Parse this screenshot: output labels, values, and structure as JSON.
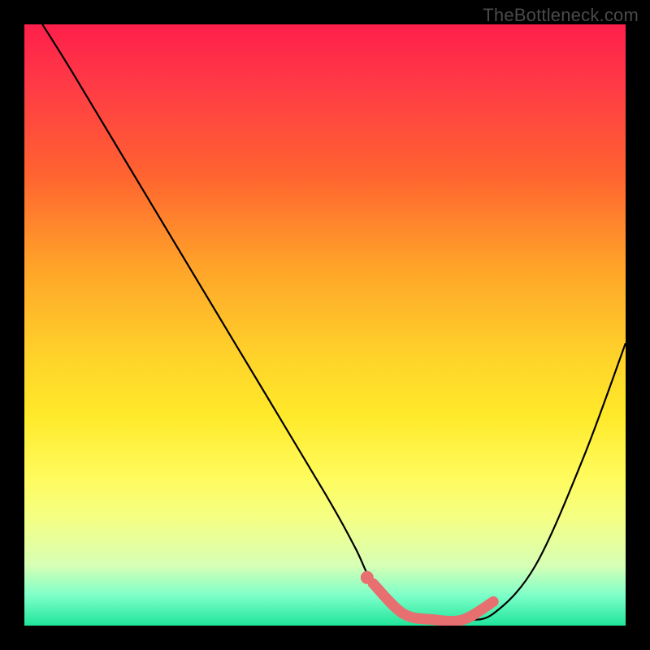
{
  "watermark": "TheBottleneck.com",
  "colors": {
    "curve": "#000000",
    "highlight": "#e76f6f",
    "highlight_dot": "#e76f6f",
    "background_frame": "#000000"
  },
  "chart_data": {
    "type": "line",
    "title": "",
    "xlabel": "",
    "ylabel": "",
    "xlim": [
      0,
      100
    ],
    "ylim": [
      0,
      100
    ],
    "grid": false,
    "legend": false,
    "series": [
      {
        "name": "bottleneck-curve",
        "x": [
          3,
          8,
          20,
          35,
          50,
          55,
          58,
          63,
          68,
          73,
          78,
          85,
          93,
          100
        ],
        "y": [
          100,
          92,
          72,
          47,
          22,
          13,
          7,
          2,
          1,
          1,
          2,
          10,
          28,
          47
        ]
      },
      {
        "name": "optimal-range-highlight",
        "x": [
          58,
          63,
          68,
          73,
          78
        ],
        "y": [
          7,
          2,
          1,
          1,
          4
        ]
      }
    ],
    "annotations": [
      {
        "kind": "point",
        "x": 57,
        "y": 8,
        "label": "highlight-start-dot"
      }
    ]
  }
}
